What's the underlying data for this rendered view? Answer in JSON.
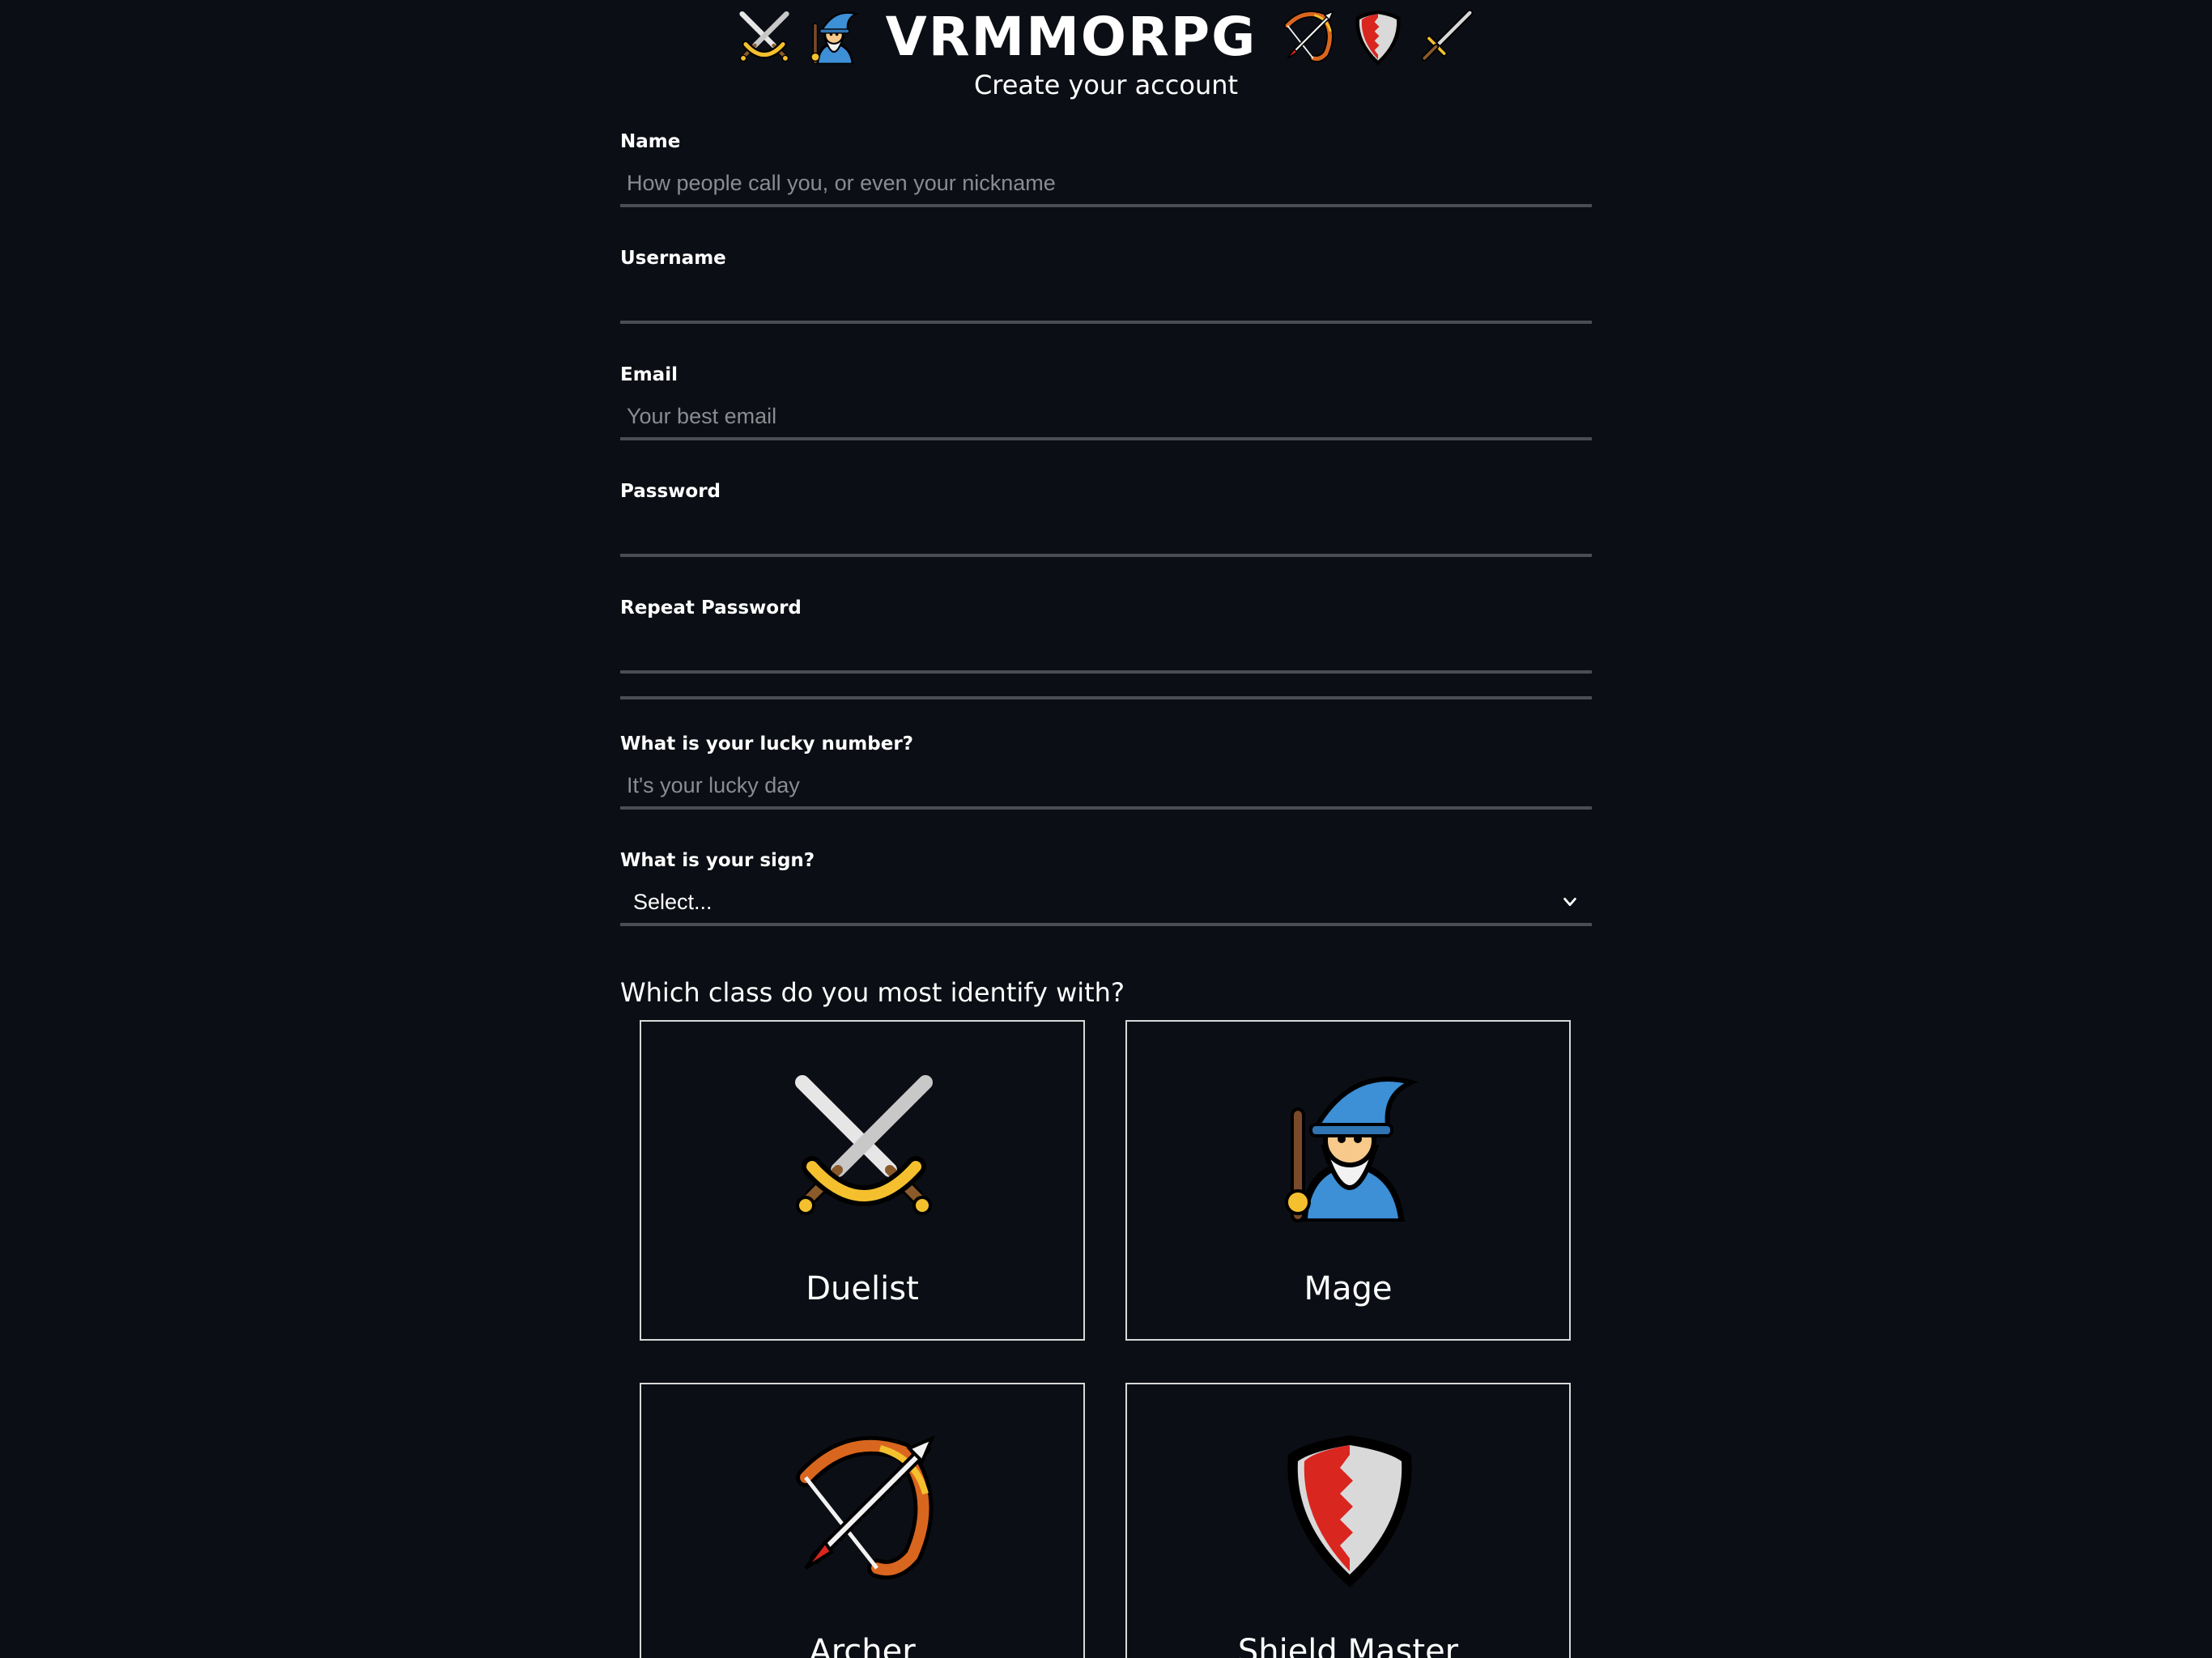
{
  "header": {
    "title": "VRMMORPG",
    "subtitle": "Create your account",
    "left_icons": [
      "crossed-swords-icon",
      "mage-icon"
    ],
    "right_icons": [
      "bow-and-arrow-icon",
      "shield-icon",
      "dagger-icon"
    ]
  },
  "form": {
    "fields": [
      {
        "label": "Name",
        "placeholder": "How people call you, or even your nickname",
        "value": ""
      },
      {
        "label": "Username",
        "placeholder": "",
        "value": ""
      },
      {
        "label": "Email",
        "placeholder": "Your best email",
        "value": ""
      },
      {
        "label": "Password",
        "placeholder": "",
        "value": ""
      },
      {
        "label": "Repeat Password",
        "placeholder": "",
        "value": ""
      },
      {
        "label": "What is your lucky number?",
        "placeholder": "It's your lucky day",
        "value": ""
      }
    ],
    "sign": {
      "label": "What is your sign?",
      "selected": "Select..."
    },
    "class_question": "Which class do you most identify with?"
  },
  "classes": [
    {
      "name": "Duelist",
      "icon": "crossed-swords-icon"
    },
    {
      "name": "Mage",
      "icon": "mage-icon"
    },
    {
      "name": "Archer",
      "icon": "bow-and-arrow-icon"
    },
    {
      "name": "Shield Master",
      "icon": "shield-icon"
    }
  ],
  "colors": {
    "background": "#0b0e14",
    "text": "#ffffff",
    "placeholder": "#8a8c90",
    "underline": "#4a4d52",
    "card_border": "#d8d8d8"
  }
}
